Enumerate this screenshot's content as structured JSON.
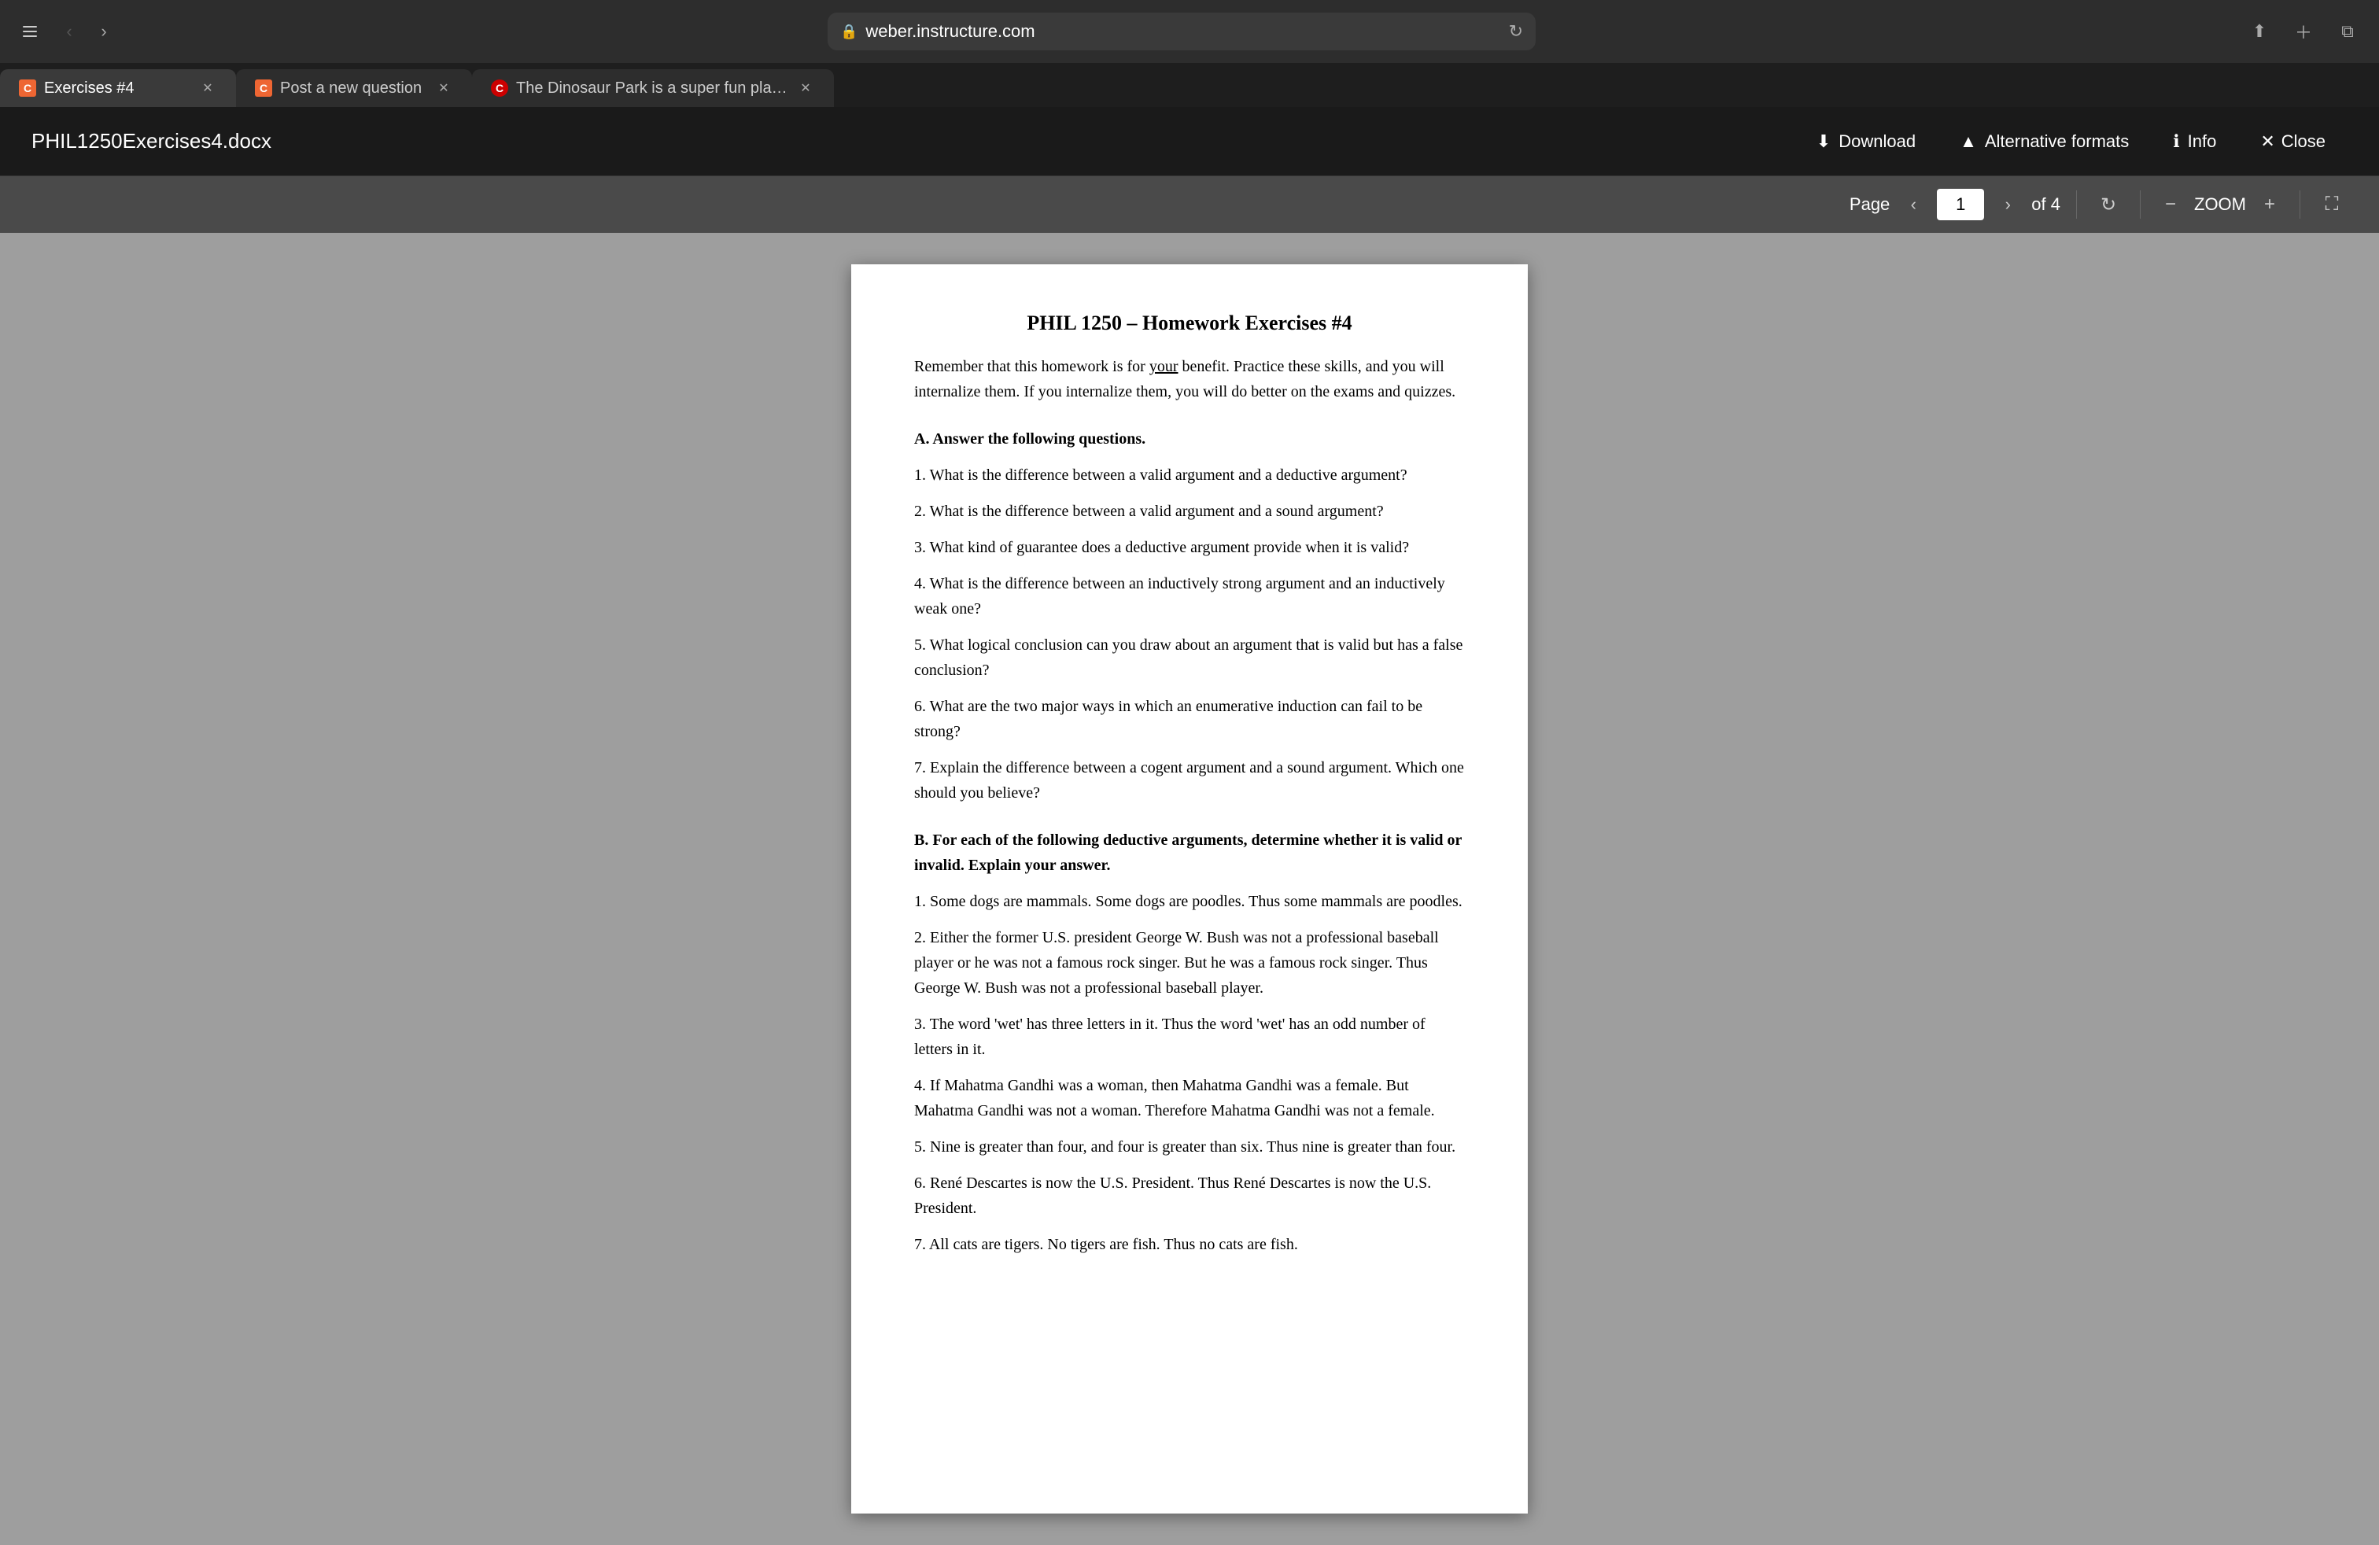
{
  "browser": {
    "url": "weber.instructure.com",
    "tabs": [
      {
        "id": "tab-exercises",
        "label": "Exercises #4",
        "favicon_type": "canvas",
        "favicon_text": "C",
        "active": true
      },
      {
        "id": "tab-post-question",
        "label": "Post a new question",
        "favicon_type": "canvas",
        "favicon_text": "C",
        "active": false
      },
      {
        "id": "tab-chegg",
        "label": "The Dinosaur Park is a super fun place for kids he... | Chegg.com",
        "favicon_type": "chegg",
        "favicon_text": "C",
        "active": false
      }
    ]
  },
  "doc_header": {
    "title": "PHIL1250Exercises4.docx",
    "download_label": "Download",
    "alternative_formats_label": "Alternative formats",
    "info_label": "Info",
    "close_label": "Close"
  },
  "pdf_toolbar": {
    "page_label": "Page",
    "current_page": "1",
    "total_pages": "of 4",
    "zoom_label": "ZOOM",
    "prev_page_title": "Previous page",
    "next_page_title": "Next page",
    "zoom_in_title": "Zoom in",
    "zoom_out_title": "Zoom out",
    "rotate_title": "Rotate",
    "fullscreen_title": "Fullscreen"
  },
  "pdf_content": {
    "title": "PHIL 1250 – Homework Exercises #4",
    "intro": "Remember that this homework is for your benefit. Practice these skills, and you will internalize them. If you internalize them, you will do better on the exams and quizzes.",
    "section_a_heading": "A. Answer the following questions.",
    "section_a_questions": [
      "1. What is the difference between a valid argument and a deductive argument?",
      "2. What is the difference between a valid argument and a sound argument?",
      "3. What kind of guarantee does a deductive argument provide when it is valid?",
      "4. What is the difference between an inductively strong argument and an inductively weak one?",
      "5. What logical conclusion can you draw about an argument that is valid but has a false conclusion?",
      "6. What are the two major ways in which an enumerative induction can fail to be strong?",
      "7. Explain the difference between a cogent argument and a sound argument. Which one should you believe?"
    ],
    "section_b_heading": "B. For each of the following deductive arguments, determine whether it is valid or invalid. Explain your answer.",
    "section_b_questions": [
      "1. Some dogs are mammals. Some dogs are poodles. Thus some mammals are poodles.",
      "2. Either the former U.S. president George W. Bush was not a professional baseball player or he was not a famous rock singer. But he was a famous rock singer. Thus George W. Bush was not a professional baseball player.",
      "3. The word 'wet' has three letters in it. Thus the word 'wet' has an odd number of letters in it.",
      "4. If Mahatma Gandhi was a woman, then Mahatma Gandhi was a female. But Mahatma Gandhi was not a woman. Therefore Mahatma Gandhi was not a female.",
      "5. Nine is greater than four, and four is greater than six. Thus nine is greater than four.",
      "6. René Descartes is now the U.S. President. Thus René Descartes is now the U.S. President.",
      "7. All cats are tigers. No tigers are fish. Thus no cats are fish."
    ]
  }
}
